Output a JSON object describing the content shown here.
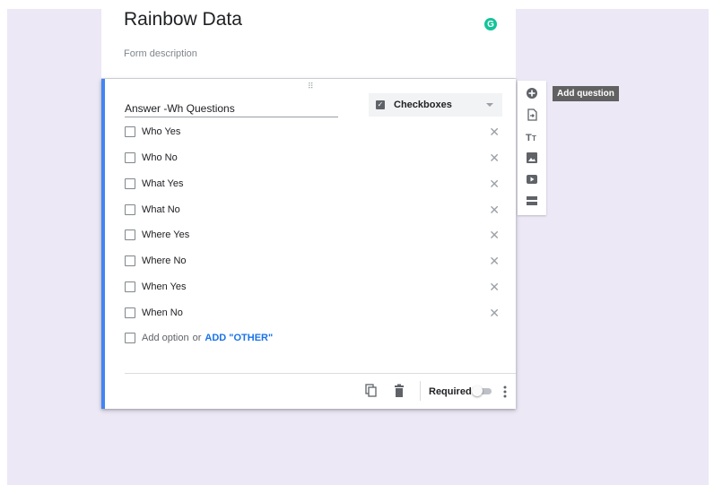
{
  "form": {
    "title": "Rainbow Data",
    "description_placeholder": "Form description",
    "grammarly_badge": "G"
  },
  "question": {
    "text": "Answer -Wh Questions",
    "type_label": "Checkboxes",
    "options": [
      {
        "label": "Who Yes"
      },
      {
        "label": "Who No"
      },
      {
        "label": "What Yes"
      },
      {
        "label": "What No"
      },
      {
        "label": "Where Yes"
      },
      {
        "label": "Where No"
      },
      {
        "label": "When Yes"
      },
      {
        "label": "When No"
      }
    ],
    "add_option_text": "Add option",
    "or_text": "or",
    "add_other_label": "ADD \"OTHER\"",
    "required_label": "Required",
    "required": false
  },
  "toolbar": {
    "tooltip": "Add question"
  },
  "icons": {
    "drag": "drag-handle-icon",
    "checkbox": "checkbox-icon",
    "remove": "close-icon",
    "copy": "copy-icon",
    "delete": "trash-icon",
    "more": "more-vert-icon",
    "add": "add-circle-icon",
    "import": "import-questions-icon",
    "title": "title-text-icon",
    "image": "image-icon",
    "video": "video-icon",
    "section": "section-icon"
  },
  "colors": {
    "accent": "#4285f4",
    "link": "#1a73e8",
    "background": "#ece8f6",
    "grammarly": "#15c39a"
  }
}
